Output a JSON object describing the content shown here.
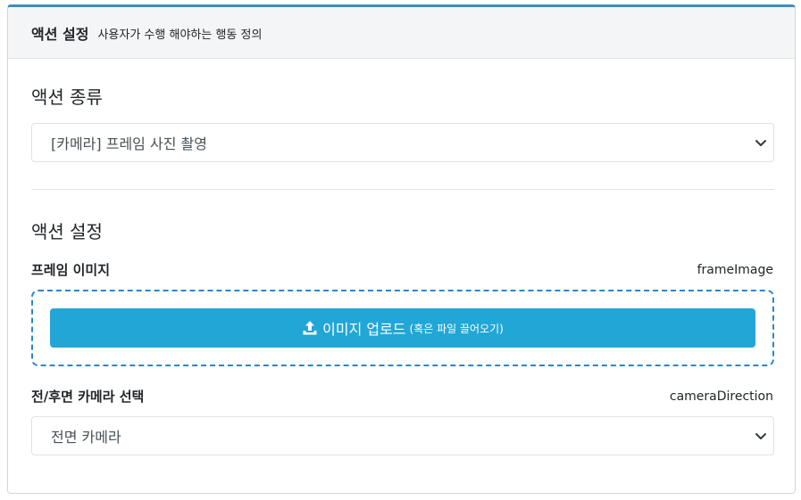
{
  "header": {
    "title": "액션 설정",
    "subtitle": "사용자가 수행 해야하는 행동 정의"
  },
  "action_type": {
    "heading": "액션 종류",
    "selected": "[카메라] 프레임 사진 촬영"
  },
  "action_settings": {
    "heading": "액션 설정",
    "frame_image": {
      "label": "프레임 이미지",
      "key": "frameImage",
      "upload_label": "이미지 업로드",
      "upload_hint": "(혹은 파일 끌어오기)"
    },
    "camera_direction": {
      "label": "전/후면 카메라 선택",
      "key": "cameraDirection",
      "selected": "전면 카메라"
    }
  },
  "colors": {
    "accent_border": "#3c8dbc",
    "upload_button": "#22a6d6",
    "dropzone_border": "#2b87c9"
  }
}
